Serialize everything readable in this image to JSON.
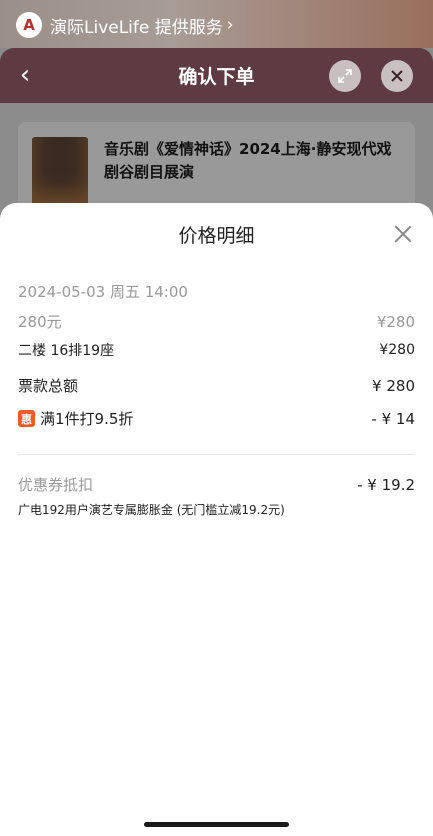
{
  "provider": {
    "logo": "A",
    "text": "演际LiveLife 提供服务",
    "chevron": "›"
  },
  "navbar": {
    "back_icon": "‹",
    "title": "确认下单"
  },
  "show": {
    "title": "音乐剧《爱情神话》2024上海·静安现代戏剧谷剧目展演"
  },
  "sheet": {
    "title": "价格明细",
    "datetime": "2024-05-03 周五 14:00",
    "price_tier": {
      "label": "280元",
      "value": "¥280"
    },
    "seat": {
      "label": "二楼 16排19座",
      "value": "¥280"
    },
    "ticket_total": {
      "label": "票款总额",
      "value": "¥ 280"
    },
    "discount": {
      "badge": "惠",
      "label": "满1件打9.5折",
      "value": "- ¥ 14"
    },
    "coupon": {
      "label": "优惠券抵扣",
      "value": "- ¥ 19.2"
    },
    "coupon_desc": "广电192用户演艺专属膨胀金 (无门槛立减19.2元)"
  },
  "colors": {
    "navbar": "#5e3a43",
    "accent_badge": "#f15a24",
    "sheet_bg": "#ffffff"
  }
}
